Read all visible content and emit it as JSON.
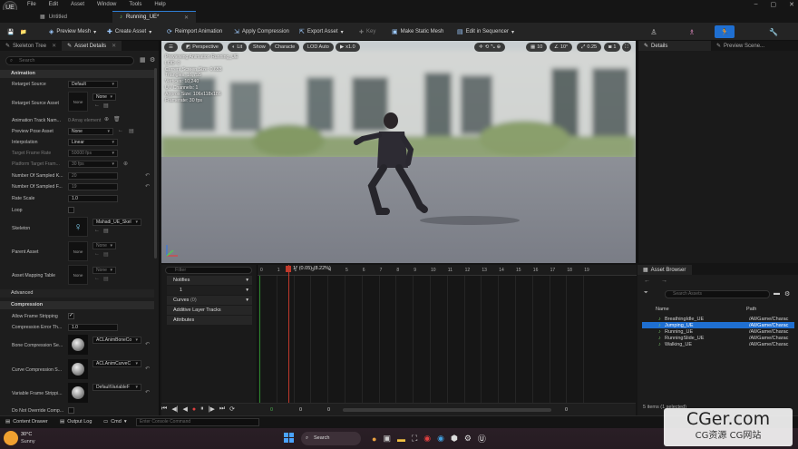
{
  "menubar": {
    "items": [
      "File",
      "Edit",
      "Asset",
      "Window",
      "Tools",
      "Help"
    ],
    "logo": "UE"
  },
  "tabs": [
    {
      "label": "Untitled",
      "icon": "level-icon"
    },
    {
      "label": "Running_UE*",
      "icon": "animation-icon"
    }
  ],
  "toolbar": {
    "preview_mesh": "Preview Mesh",
    "create_asset": "Create Asset",
    "reimport": "Reimport Animation",
    "apply_compression": "Apply Compression",
    "export_asset": "Export Asset",
    "key": "Key",
    "make_static_mesh": "Make Static Mesh",
    "edit_in_sequencer": "Edit in Sequencer"
  },
  "left_panel": {
    "tab_skeleton_tree": "Skeleton Tree",
    "tab_asset_details": "Asset Details",
    "search_placeholder": "Search",
    "section_animation": "Animation",
    "retarget_source": "Retarget Source",
    "retarget_source_value": "Default",
    "retarget_source_asset": "Retarget Source Asset",
    "none": "None",
    "anim_track_names": "Animation Track Nam...",
    "anim_track_value": "0 Array element",
    "preview_pose_asset": "Preview Pose Asset",
    "interpolation": "Interpolation",
    "interpolation_value": "Linear",
    "target_frame_rate": "Target Frame Rate",
    "target_frame_rate_value": "50000 fps",
    "platform_target": "Platform Target Fram...",
    "platform_target_value": "30 fps",
    "num_sampled_keys": "Number Of Sampled K...",
    "num_sampled_keys_value": "20",
    "num_sampled_frames": "Number Of Sampled F...",
    "num_sampled_frames_value": "19",
    "rate_scale": "Rate Scale",
    "rate_scale_value": "1.0",
    "loop": "Loop",
    "skeleton": "Skeleton",
    "skeleton_value": "Mahadi_UE_Skel",
    "parent_asset": "Parent Asset",
    "asset_mapping_table": "Asset Mapping Table",
    "section_advanced": "Advanced",
    "section_compression": "Compression",
    "allow_frame_stripping": "Allow Frame Stripping",
    "compression_error": "Compression Error Th...",
    "compression_error_value": "1.0",
    "bone_compression": "Bone Compression Se...",
    "bone_compression_value": "ACLAnimBoneCo",
    "curve_compression": "Curve Compression S...",
    "curve_compression_value": "ACLAnimCurveC",
    "variable_frame": "Variable Frame Strippi...",
    "variable_frame_value": "DefaultVariableF",
    "do_not_override": "Do Not Override Comp..."
  },
  "viewport": {
    "btn_perspective": "Perspective",
    "btn_lit": "Lit",
    "btn_show": "Show",
    "btn_character": "Characte",
    "btn_lod": "LOD Auto",
    "btn_speed": "x1.0",
    "grid_snap": "10",
    "rot_snap": "10°",
    "scale_snap": "0.25",
    "cam_speed": "1",
    "stats": [
      "Previewing Animation Running_UE",
      "LOD: 0",
      "Current Screen Size: 0.653",
      "Triangles: 16,755",
      "Vertices: 10,240",
      "UV Channels: 1",
      "Approx Size: 106x118x186",
      "Framerate: 30 fps"
    ]
  },
  "details": {
    "tab_details": "Details",
    "tab_preview_scene": "Preview Scene..."
  },
  "timeline": {
    "filter_placeholder": "Filter",
    "notifies": "Notifies",
    "notify_track": "1",
    "curves": "Curves",
    "curves_count": "(0)",
    "additive": "Additive Layer Tracks",
    "attributes": "Attributes",
    "playhead_label": "1* (0.05) (8.22%)",
    "ruler_ticks": [
      "0",
      "1",
      "2",
      "3",
      "4",
      "5",
      "6",
      "7",
      "8",
      "9",
      "10",
      "11",
      "12",
      "13",
      "14",
      "15",
      "16",
      "17",
      "18",
      "19"
    ],
    "start_frame": "0",
    "current_frame": "0",
    "end_frame": "0"
  },
  "asset_browser": {
    "tab": "Asset Browser",
    "search_placeholder": "Search Assets",
    "col_name": "Name",
    "col_path": "Path",
    "assets": [
      {
        "name": "BreathingIdle_UE",
        "path": "/All/Game/Charac",
        "selected": false
      },
      {
        "name": "Jumping_UE",
        "path": "/All/Game/Charac",
        "selected": true
      },
      {
        "name": "Running_UE",
        "path": "/All/Game/Charac",
        "selected": false
      },
      {
        "name": "RunningSlide_UE",
        "path": "/All/Game/Charac",
        "selected": false
      },
      {
        "name": "Walking_UE",
        "path": "/All/Game/Charac",
        "selected": false
      }
    ],
    "count": "5 items (1 selected)"
  },
  "bottombar": {
    "content_drawer": "Content Drawer",
    "output_log": "Output Log",
    "cmd": "Cmd",
    "console_placeholder": "Enter Console Command"
  },
  "taskbar": {
    "temperature": "30°C",
    "weather": "Sunny",
    "search": "Search"
  },
  "watermark": {
    "main": "CGer.com",
    "sub": "CG资源 CG网站"
  },
  "colors": {
    "accent": "#1f6fd1",
    "panel": "#1d1d1d",
    "background": "#151515"
  }
}
